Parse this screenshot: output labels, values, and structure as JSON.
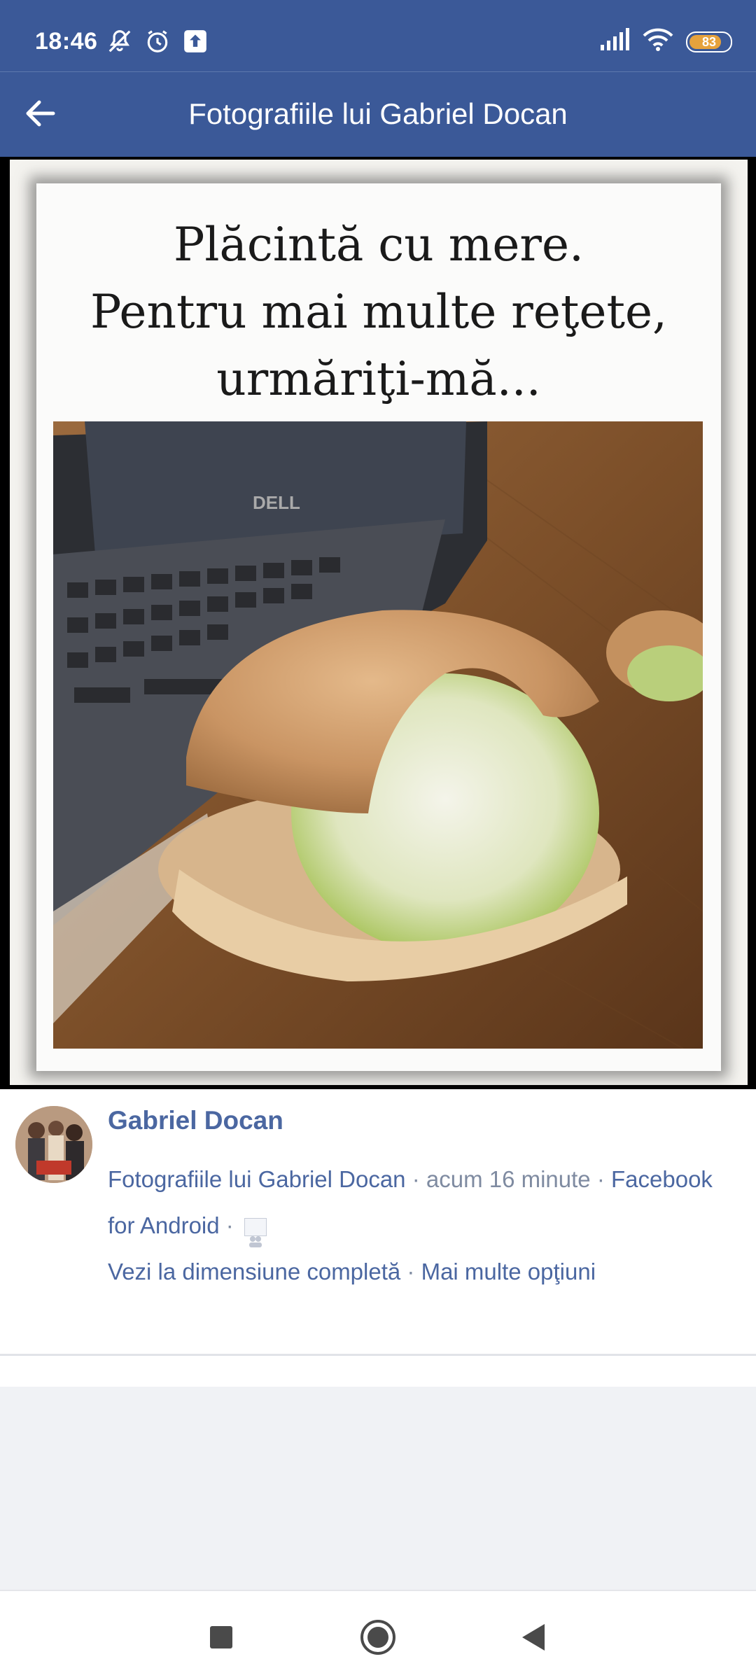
{
  "status_bar": {
    "time": "18:46",
    "battery": "83",
    "icons_left": [
      "mute-icon",
      "alarm-icon",
      "upload-icon"
    ],
    "icons_right": [
      "signal-icon",
      "wifi-icon",
      "battery-icon"
    ]
  },
  "app_bar": {
    "title": "Fotografiile lui Gabriel Docan"
  },
  "photo": {
    "caption_lines": [
      "Plăcintă cu mere.",
      "Pentru mai multe reţete,",
      "urmăriţi-mă..."
    ],
    "brand_on_laptop": "DELL"
  },
  "post": {
    "author": "Gabriel Docan",
    "album_link": "Fotografiile lui Gabriel Docan",
    "separator": " · ",
    "time_ago": "acum 16 minute",
    "source_link": "Facebook for Android",
    "full_size_link": "Vezi la dimensiune completă",
    "more_options_link": "Mai multe opţiuni"
  },
  "colors": {
    "brand_blue": "#3b5998",
    "link_blue": "#4b67a1",
    "meta_gray": "#7f8ba1",
    "battery_orange": "#e6a23c"
  }
}
